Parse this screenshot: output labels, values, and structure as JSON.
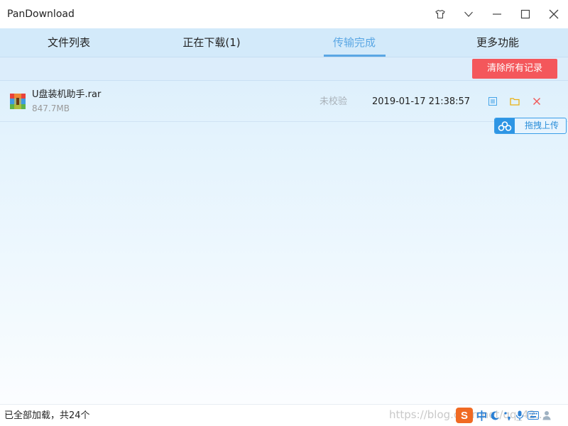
{
  "app": {
    "title": "PanDownload"
  },
  "title_controls": [
    {
      "name": "shirt-icon"
    },
    {
      "name": "chevron-down-icon"
    },
    {
      "name": "minimize-icon"
    },
    {
      "name": "maximize-icon"
    },
    {
      "name": "close-icon"
    }
  ],
  "tabs": [
    {
      "label": "文件列表",
      "active": false
    },
    {
      "label": "正在下载(1)",
      "active": false
    },
    {
      "label": "传输完成",
      "active": true
    },
    {
      "label": "更多功能",
      "active": false
    }
  ],
  "toolbar": {
    "clear_label": "清除所有记录"
  },
  "files": [
    {
      "name": "U盘装机助手.rar",
      "size": "847.7MB",
      "status": "未校验",
      "completed_at": "2019-01-17 21:38:57",
      "icon": "winrar-archive-icon"
    }
  ],
  "drag_upload": {
    "label": "拖拽上传",
    "icon": "baidu-cloud-icon"
  },
  "statusbar": {
    "text": "已全部加载，共24个",
    "watermark": "https://blog.csdn.net/qq_42..."
  },
  "ime": {
    "logo": "S",
    "mode": "中"
  },
  "colors": {
    "accent": "#5aa7e4",
    "danger": "#f4575b",
    "upload_blue": "#2e95e4"
  }
}
